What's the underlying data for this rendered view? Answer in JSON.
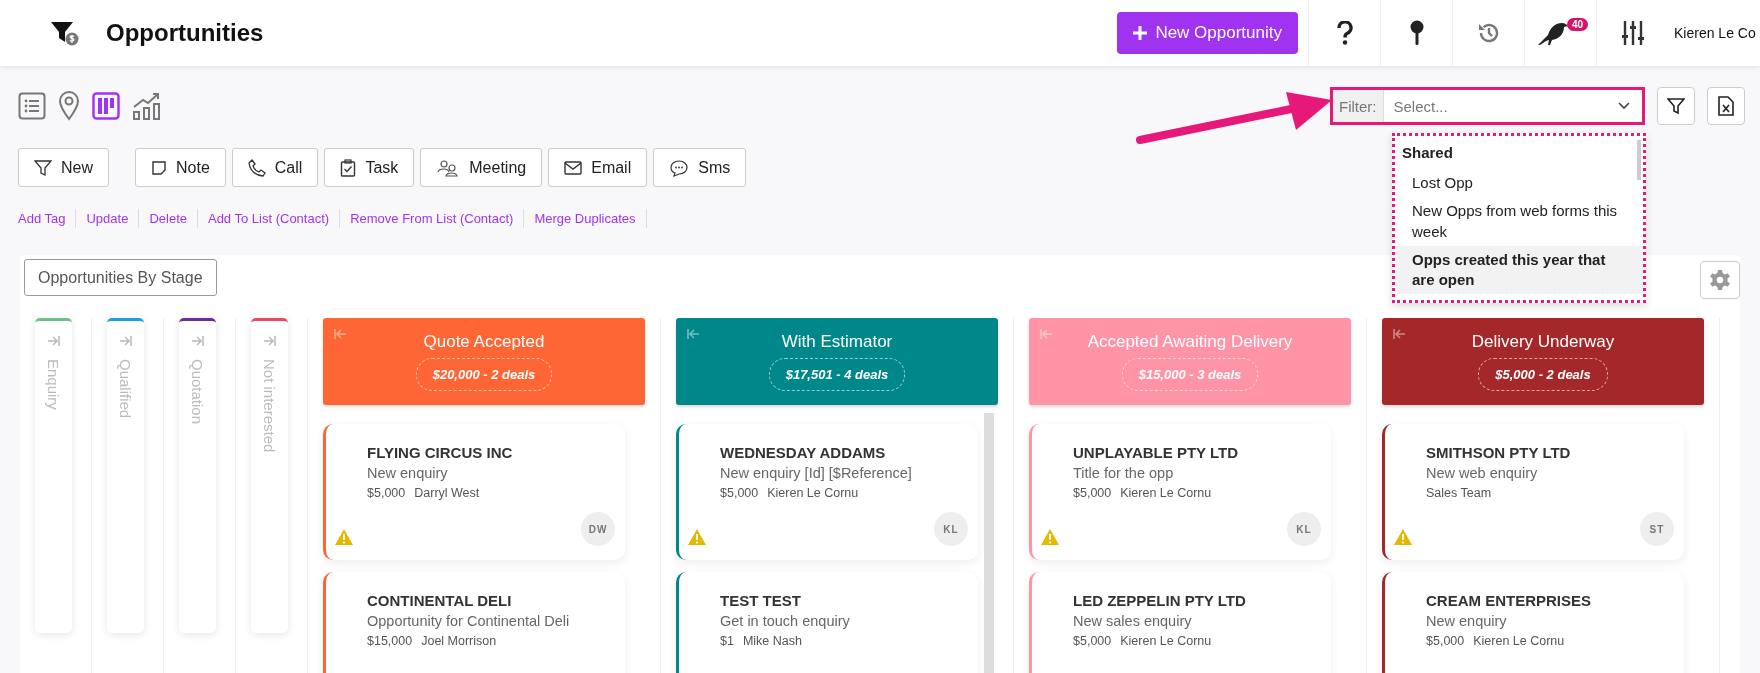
{
  "header": {
    "title": "Opportunities",
    "new_button": "New Opportunity",
    "notification_count": "40",
    "user_name": "Kieren Le Co"
  },
  "view_modes": [
    {
      "kind": "list",
      "selected": false
    },
    {
      "kind": "map",
      "selected": false
    },
    {
      "kind": "board",
      "selected": true
    },
    {
      "kind": "chart",
      "selected": false
    }
  ],
  "filter": {
    "label": "Filter:",
    "placeholder": "Select...",
    "dropdown": {
      "group": "Shared",
      "options": [
        {
          "label": "Lost Opp",
          "selected": false
        },
        {
          "label": "New Opps from web forms this week",
          "selected": false
        },
        {
          "label": "Opps created this year that are open",
          "selected": true
        }
      ]
    }
  },
  "actions": [
    {
      "kind": "filter",
      "label": "New"
    },
    {
      "kind": "note",
      "label": "Note"
    },
    {
      "kind": "call",
      "label": "Call"
    },
    {
      "kind": "task",
      "label": "Task"
    },
    {
      "kind": "meeting",
      "label": "Meeting"
    },
    {
      "kind": "email",
      "label": "Email"
    },
    {
      "kind": "sms",
      "label": "Sms"
    }
  ],
  "bulk_links": [
    "Add Tag",
    "Update",
    "Delete",
    "Add To List (Contact)",
    "Remove From List (Contact)",
    "Merge Duplicates"
  ],
  "board": {
    "title": "Opportunities By Stage",
    "collapsed_stages": [
      {
        "name": "Enquiry",
        "color": "#6dbf8a"
      },
      {
        "name": "Qualified",
        "color": "#1e9ee0"
      },
      {
        "name": "Quotation",
        "color": "#6a2c9e"
      },
      {
        "name": "Not interested",
        "color": "#e84a5f"
      }
    ],
    "stages": [
      {
        "name": "Quote Accepted",
        "summary": "$20,000 - 2 deals",
        "color": "#ff6636",
        "cards": [
          {
            "company": "FLYING CIRCUS INC",
            "title": "New enquiry",
            "amount": "$5,000",
            "owner": "Darryl West",
            "initials": "DW",
            "warning": true
          },
          {
            "company": "CONTINENTAL DELI",
            "title": "Opportunity for Continental Deli",
            "amount": "$15,000",
            "owner": "Joel Morrison",
            "warning": false
          }
        ]
      },
      {
        "name": "With Estimator",
        "summary": "$17,501 - 4 deals",
        "color": "#00878a",
        "cards": [
          {
            "company": "WEDNESDAY ADDAMS",
            "title": "New enquiry [Id] [$Reference]",
            "amount": "$5,000",
            "owner": "Kieren Le Cornu",
            "initials": "KL",
            "warning": true
          },
          {
            "company": "TEST TEST",
            "title": "Get in touch enquiry",
            "amount": "$1",
            "owner": "Mike Nash",
            "warning": false
          }
        ]
      },
      {
        "name": "Accepted Awaiting Delivery",
        "summary": "$15,000 - 3 deals",
        "color": "#ff94a6",
        "cards": [
          {
            "company": "UNPLAYABLE PTY LTD",
            "title": "Title for the opp",
            "amount": "$5,000",
            "owner": "Kieren Le Cornu",
            "initials": "KL",
            "warning": true
          },
          {
            "company": "LED ZEPPELIN PTY LTD",
            "title": "New sales enquiry",
            "amount": "$5,000",
            "owner": "Kieren Le Cornu",
            "warning": false
          }
        ]
      },
      {
        "name": "Delivery Underway",
        "summary": "$5,000 - 2 deals",
        "color": "#a4282a",
        "cards": [
          {
            "company": "SMITHSON PTY LTD",
            "title": "New web enquiry",
            "owner": "Sales Team",
            "initials": "ST",
            "warning": true
          },
          {
            "company": "CREAM ENTERPRISES",
            "title": "New enquiry",
            "amount": "$5,000",
            "owner": "Kieren Le Cornu",
            "warning": false
          }
        ]
      }
    ]
  }
}
